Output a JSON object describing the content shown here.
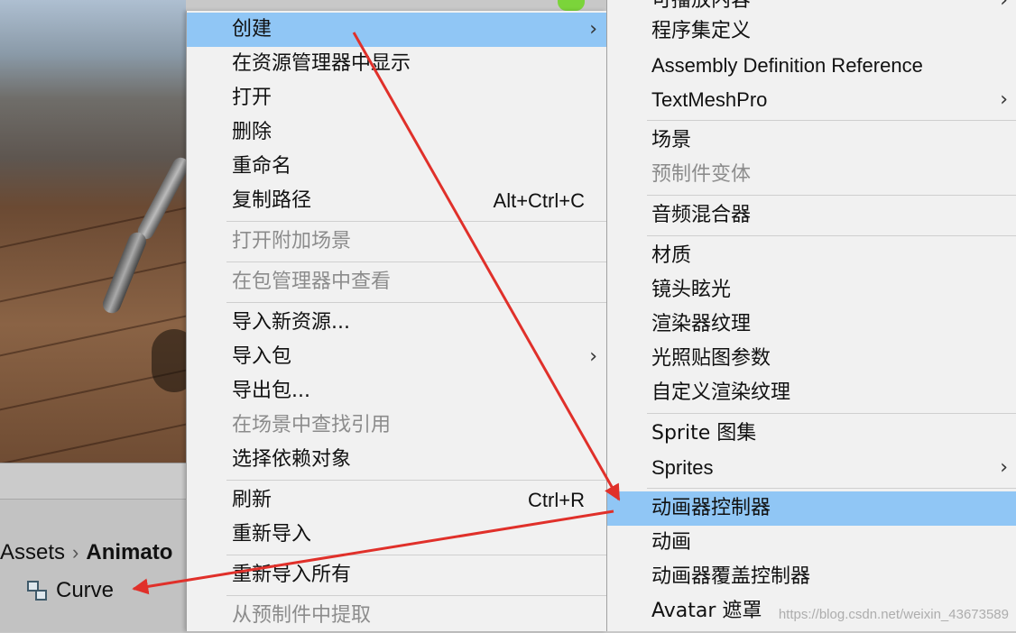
{
  "project": {
    "breadcrumb_root": "Assets",
    "breadcrumb_current": "Animato",
    "asset_name": "Curve"
  },
  "context_menu": [
    {
      "label": "创建",
      "submenu": true,
      "highlighted": true
    },
    {
      "label": "在资源管理器中显示"
    },
    {
      "label": "打开"
    },
    {
      "label": "删除"
    },
    {
      "label": "重命名"
    },
    {
      "label": "复制路径",
      "shortcut": "Alt+Ctrl+C"
    },
    {
      "label": "打开附加场景",
      "disabled": true
    },
    {
      "label": "在包管理器中查看",
      "disabled": true
    },
    {
      "label": "导入新资源..."
    },
    {
      "label": "导入包",
      "submenu": true
    },
    {
      "label": "导出包..."
    },
    {
      "label": "在场景中查找引用",
      "disabled": true
    },
    {
      "label": "选择依赖对象"
    },
    {
      "label": "刷新",
      "shortcut": "Ctrl+R"
    },
    {
      "label": "重新导入"
    },
    {
      "label": "重新导入所有"
    },
    {
      "label": "从预制件中提取",
      "disabled": true
    }
  ],
  "create_submenu": [
    {
      "label": "可播放内容",
      "submenu": true
    },
    {
      "label": "程序集定义"
    },
    {
      "label": "Assembly Definition Reference"
    },
    {
      "label": "TextMeshPro",
      "submenu": true
    },
    {
      "label": "场景"
    },
    {
      "label": "预制件变体",
      "disabled": true
    },
    {
      "label": "音频混合器"
    },
    {
      "label": "材质"
    },
    {
      "label": "镜头眩光"
    },
    {
      "label": "渲染器纹理"
    },
    {
      "label": "光照贴图参数"
    },
    {
      "label": "自定义渲染纹理"
    },
    {
      "label": "Sprite 图集"
    },
    {
      "label": "Sprites",
      "submenu": true
    },
    {
      "label": "动画器控制器",
      "highlighted": true
    },
    {
      "label": "动画"
    },
    {
      "label": "动画器覆盖控制器"
    },
    {
      "label": "Avatar 遮罩"
    }
  ],
  "submenu_arrow_glyph": "›",
  "watermark": "https://blog.csdn.net/weixin_43673589",
  "colors": {
    "menu_bg": "#f1f1f1",
    "highlight": "#90c6f5",
    "disabled_text": "#8c8c8c",
    "annotation_arrow": "#e0302a"
  }
}
